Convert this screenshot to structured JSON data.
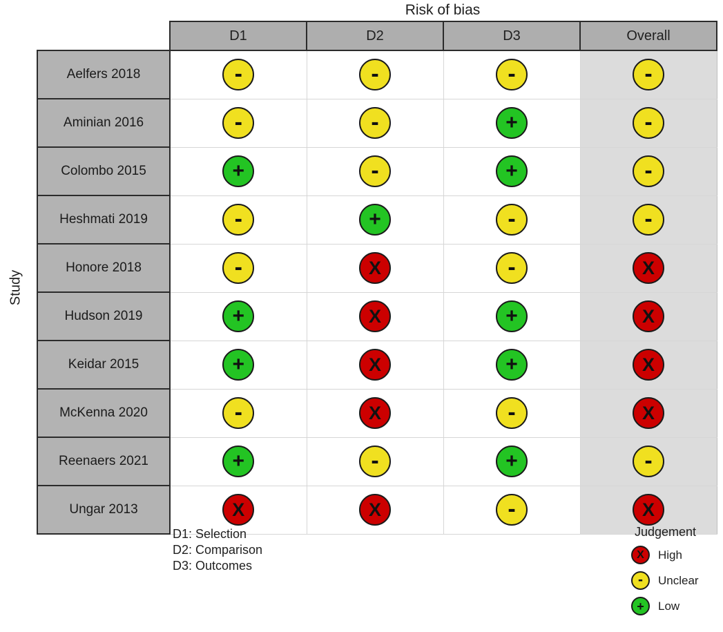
{
  "chart_data": {
    "type": "table",
    "title": "Risk of bias",
    "ylabel": "Study",
    "xlabel": "",
    "columns": [
      "D1",
      "D2",
      "D3",
      "Overall"
    ],
    "categories": [
      "Aelfers 2018",
      "Aminian 2016",
      "Colombo 2015",
      "Heshmati 2019",
      "Honore 2018",
      "Hudson 2019",
      "Keidar 2015",
      "McKenna 2020",
      "Reenaers 2021",
      "Ungar 2013"
    ],
    "rows": [
      {
        "study": "Aelfers 2018",
        "values": [
          "unclear",
          "unclear",
          "unclear",
          "unclear"
        ]
      },
      {
        "study": "Aminian 2016",
        "values": [
          "unclear",
          "unclear",
          "low",
          "unclear"
        ]
      },
      {
        "study": "Colombo 2015",
        "values": [
          "low",
          "unclear",
          "low",
          "unclear"
        ]
      },
      {
        "study": "Heshmati 2019",
        "values": [
          "unclear",
          "low",
          "unclear",
          "unclear"
        ]
      },
      {
        "study": "Honore 2018",
        "values": [
          "unclear",
          "high",
          "unclear",
          "high"
        ]
      },
      {
        "study": "Hudson 2019",
        "values": [
          "low",
          "high",
          "low",
          "high"
        ]
      },
      {
        "study": "Keidar 2015",
        "values": [
          "low",
          "high",
          "low",
          "high"
        ]
      },
      {
        "study": "McKenna 2020",
        "values": [
          "unclear",
          "high",
          "unclear",
          "high"
        ]
      },
      {
        "study": "Reenaers 2021",
        "values": [
          "low",
          "unclear",
          "low",
          "unclear"
        ]
      },
      {
        "study": "Ungar 2013",
        "values": [
          "high",
          "high",
          "unclear",
          "high"
        ]
      }
    ],
    "judgement_levels": [
      {
        "key": "high",
        "label": "High",
        "glyph": "X",
        "color": "#cc0000"
      },
      {
        "key": "unclear",
        "label": "Unclear",
        "glyph": "-",
        "color": "#f0e020"
      },
      {
        "key": "low",
        "label": "Low",
        "glyph": "+",
        "color": "#23c423"
      }
    ],
    "legend_position": "bottom-right",
    "grid": true
  },
  "title": "Risk of bias",
  "axis": {
    "y_title": "Study"
  },
  "domain_key": {
    "lines": [
      "D1: Selection",
      "D2: Comparison",
      "D3: Outcomes"
    ]
  },
  "legend": {
    "title": "Judgement",
    "items": [
      {
        "label": "High",
        "glyph": "X",
        "level": "high"
      },
      {
        "label": "Unclear",
        "glyph": "-",
        "level": "unclear"
      },
      {
        "label": "Low",
        "glyph": "+",
        "level": "low"
      }
    ]
  },
  "colors": {
    "high": "#cc0000",
    "unclear": "#f0e020",
    "low": "#23c423",
    "header_cell": "#aeaeae",
    "study_cell": "#b3b3b3",
    "overall_cell": "#dcdcdc",
    "cell_border": "#2b2b2b",
    "grid_line": "#d6d6d6"
  }
}
